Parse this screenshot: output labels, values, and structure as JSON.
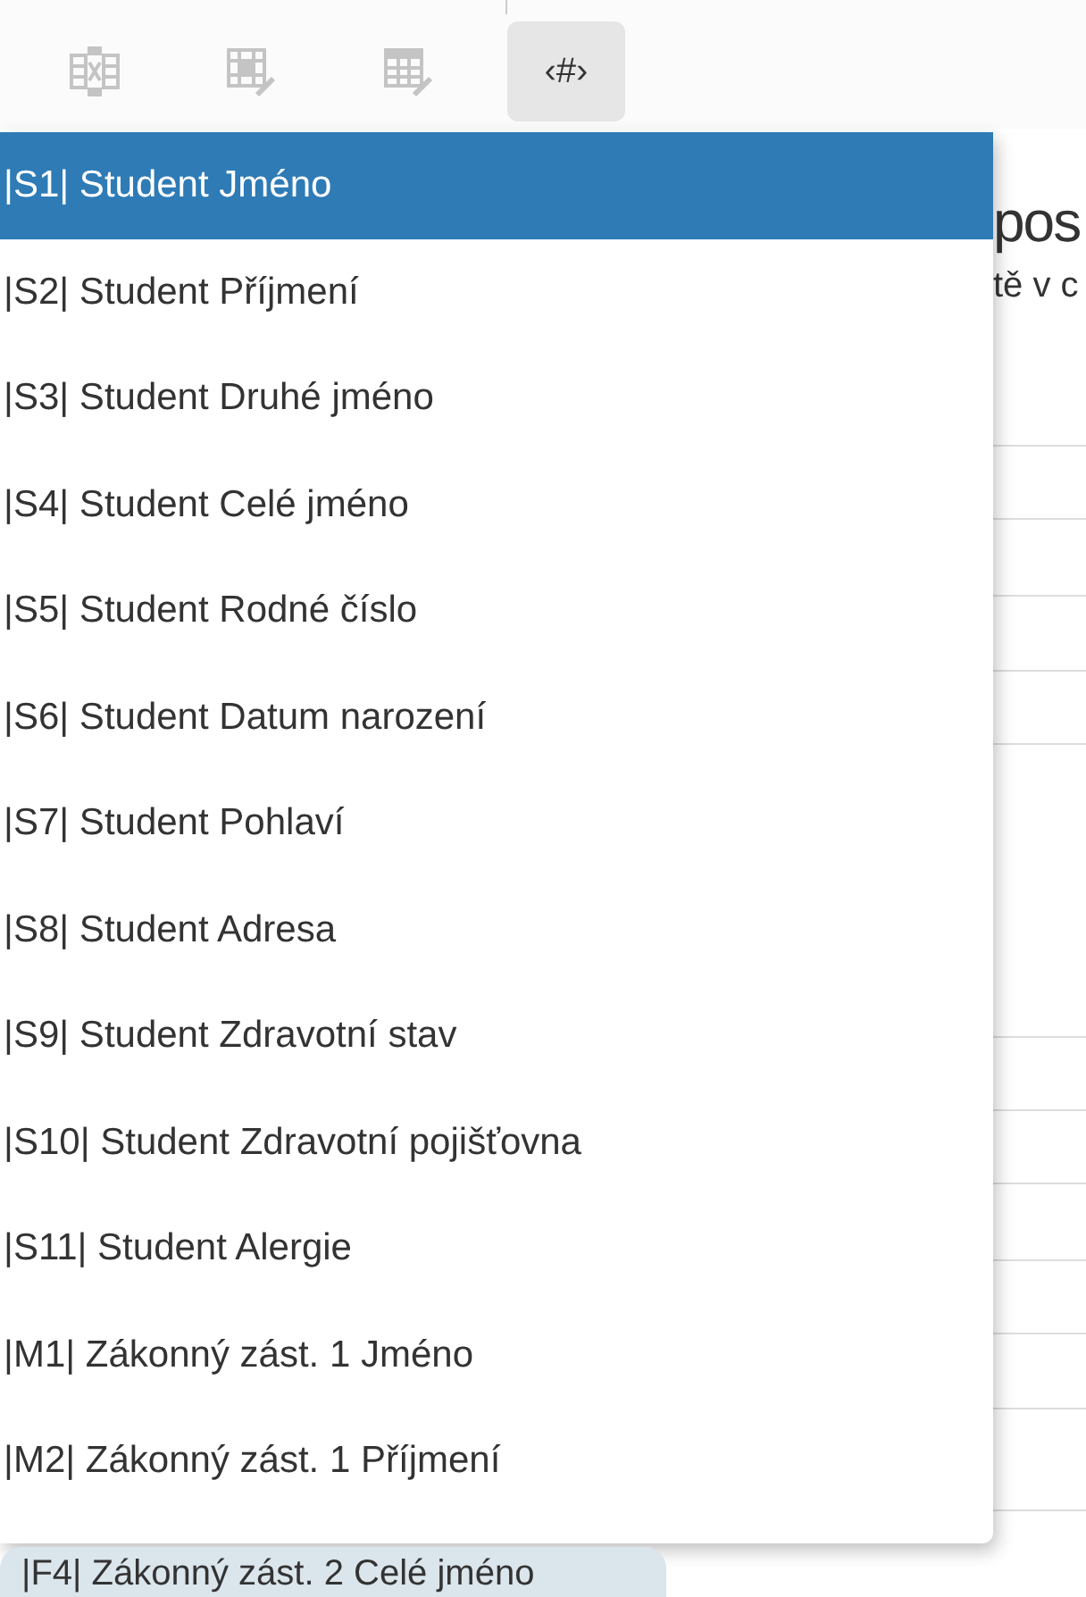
{
  "toolbar": [
    {
      "kind": "delete-table",
      "selected": false
    },
    {
      "kind": "cell-edit",
      "selected": false
    },
    {
      "kind": "table-edit",
      "selected": false
    },
    {
      "kind": "text",
      "label": "‹#›",
      "selected": true
    }
  ],
  "page": {
    "heading": "pos",
    "text": "tě v c"
  },
  "menu": [
    {
      "label": "|S1| Student Jméno",
      "selected": true
    },
    {
      "label": "|S2| Student Příjmení",
      "selected": false
    },
    {
      "label": "|S3| Student Druhé jméno",
      "selected": false
    },
    {
      "label": "|S4| Student Celé jméno",
      "selected": false
    },
    {
      "label": "|S5| Student Rodné číslo",
      "selected": false
    },
    {
      "label": "|S6| Student Datum narození",
      "selected": false
    },
    {
      "label": "|S7| Student Pohlaví",
      "selected": false
    },
    {
      "label": "|S8| Student Adresa",
      "selected": false
    },
    {
      "label": "|S9| Student Zdravotní stav",
      "selected": false
    },
    {
      "label": "|S10| Student Zdravotní pojišťovna",
      "selected": false
    },
    {
      "label": "|S11| Student Alergie",
      "selected": false
    },
    {
      "label": "|M1| Zákonný zást. 1 Jméno",
      "selected": false
    },
    {
      "label": "|M2| Zákonný zást. 1 Příjmení",
      "selected": false
    }
  ],
  "tag": {
    "label": "|F4| Zákonný zást. 2 Celé jméno"
  }
}
